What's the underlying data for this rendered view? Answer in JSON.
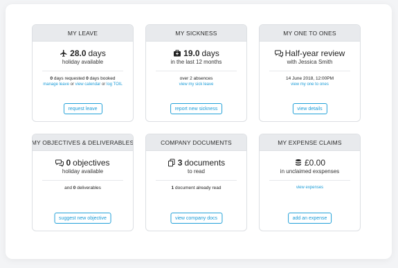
{
  "leave": {
    "title": "MY LEAVE",
    "icon": "airplane-icon",
    "value": "28.0",
    "unit": "days",
    "sub": "holiday available",
    "requested_count": "0",
    "requested_text": "days requested",
    "booked_count": "0",
    "booked_text": "days booked",
    "link_manage": "manage leave",
    "or1": "or",
    "link_calendar": "view calendar",
    "or2": "or",
    "link_toil": "log TOIL",
    "button": "request leave"
  },
  "sickness": {
    "title": "MY SICKNESS",
    "icon": "medical-kit-icon",
    "value": "19.0",
    "unit": "days",
    "sub": "in the last 12 months",
    "line": "over 2 absences",
    "link": "view my sick leave",
    "button": "report new sickness"
  },
  "one_to_ones": {
    "title": "MY ONE TO ONES",
    "icon": "chat-bubbles-icon",
    "main": "Half-year review",
    "sub": "with Jessica Smith",
    "line": "14 June 2018, 12:00PM",
    "link": "view my one to ones",
    "button": "view details"
  },
  "objectives": {
    "title": "MY OBJECTIVES & DELIVERABLES",
    "icon": "chat-bubbles-icon",
    "value": "0",
    "unit": "objectives",
    "sub": "holiday available",
    "pre": "and",
    "count": "0",
    "post": "deliverables",
    "button": "suggest new objective"
  },
  "documents": {
    "title": "COMPANY DOCUMENTS",
    "icon": "documents-icon",
    "value": "3",
    "unit": "documents",
    "sub": "to read",
    "count": "1",
    "post": "document already read",
    "button": "view company docs"
  },
  "expenses": {
    "title": "MY EXPENSE CLAIMS",
    "icon": "coins-icon",
    "value": "£0.00",
    "sub": "in unclaimed exspenses",
    "link": "view expenses",
    "button": "add an expense"
  },
  "colors": {
    "accent": "#1a9bd7",
    "header_bg": "#e8eaed",
    "border": "#dcdfe3"
  }
}
